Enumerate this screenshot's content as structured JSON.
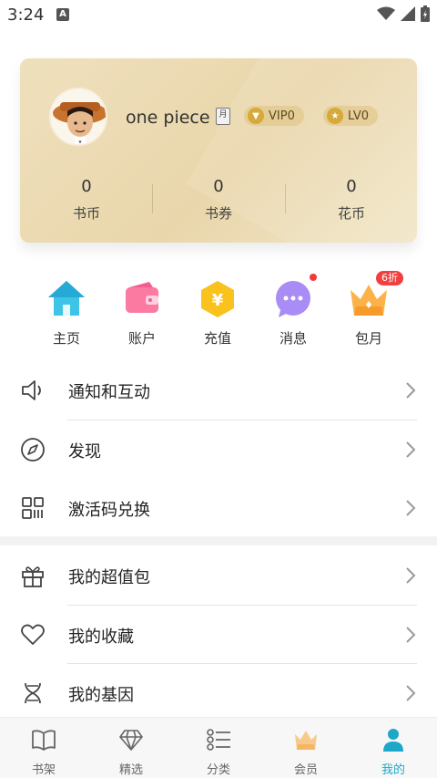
{
  "status_bar": {
    "time": "3:24",
    "notification_badge": "A"
  },
  "profile": {
    "username": "one piece",
    "month_badge": "月",
    "vip_label": "VIP0",
    "level_label": "LV0",
    "stats": [
      {
        "value": "0",
        "label": "书币"
      },
      {
        "value": "0",
        "label": "书券"
      },
      {
        "value": "0",
        "label": "花币"
      }
    ]
  },
  "quick_actions": [
    {
      "label": "主页",
      "icon": "home-icon"
    },
    {
      "label": "账户",
      "icon": "wallet-icon"
    },
    {
      "label": "充值",
      "icon": "yen-icon"
    },
    {
      "label": "消息",
      "icon": "message-icon"
    },
    {
      "label": "包月",
      "icon": "crown-icon",
      "badge": "6折"
    }
  ],
  "menu_section_1": [
    {
      "label": "通知和互动",
      "icon": "speaker-icon"
    },
    {
      "label": "发现",
      "icon": "compass-icon"
    },
    {
      "label": "激活码兑换",
      "icon": "qr-code-icon"
    }
  ],
  "menu_section_2": [
    {
      "label": "我的超值包",
      "icon": "gift-icon"
    },
    {
      "label": "我的收藏",
      "icon": "heart-icon"
    },
    {
      "label": "我的基因",
      "icon": "dna-icon"
    }
  ],
  "tabs": [
    {
      "label": "书架",
      "icon": "book-icon"
    },
    {
      "label": "精选",
      "icon": "diamond-icon"
    },
    {
      "label": "分类",
      "icon": "list-icon"
    },
    {
      "label": "会员",
      "icon": "crown-icon"
    },
    {
      "label": "我的",
      "icon": "person-icon",
      "active": true
    }
  ],
  "colors": {
    "accent": "#1ea8c8",
    "card_gold": "#ecd9b0",
    "red_badge": "#f04040"
  }
}
